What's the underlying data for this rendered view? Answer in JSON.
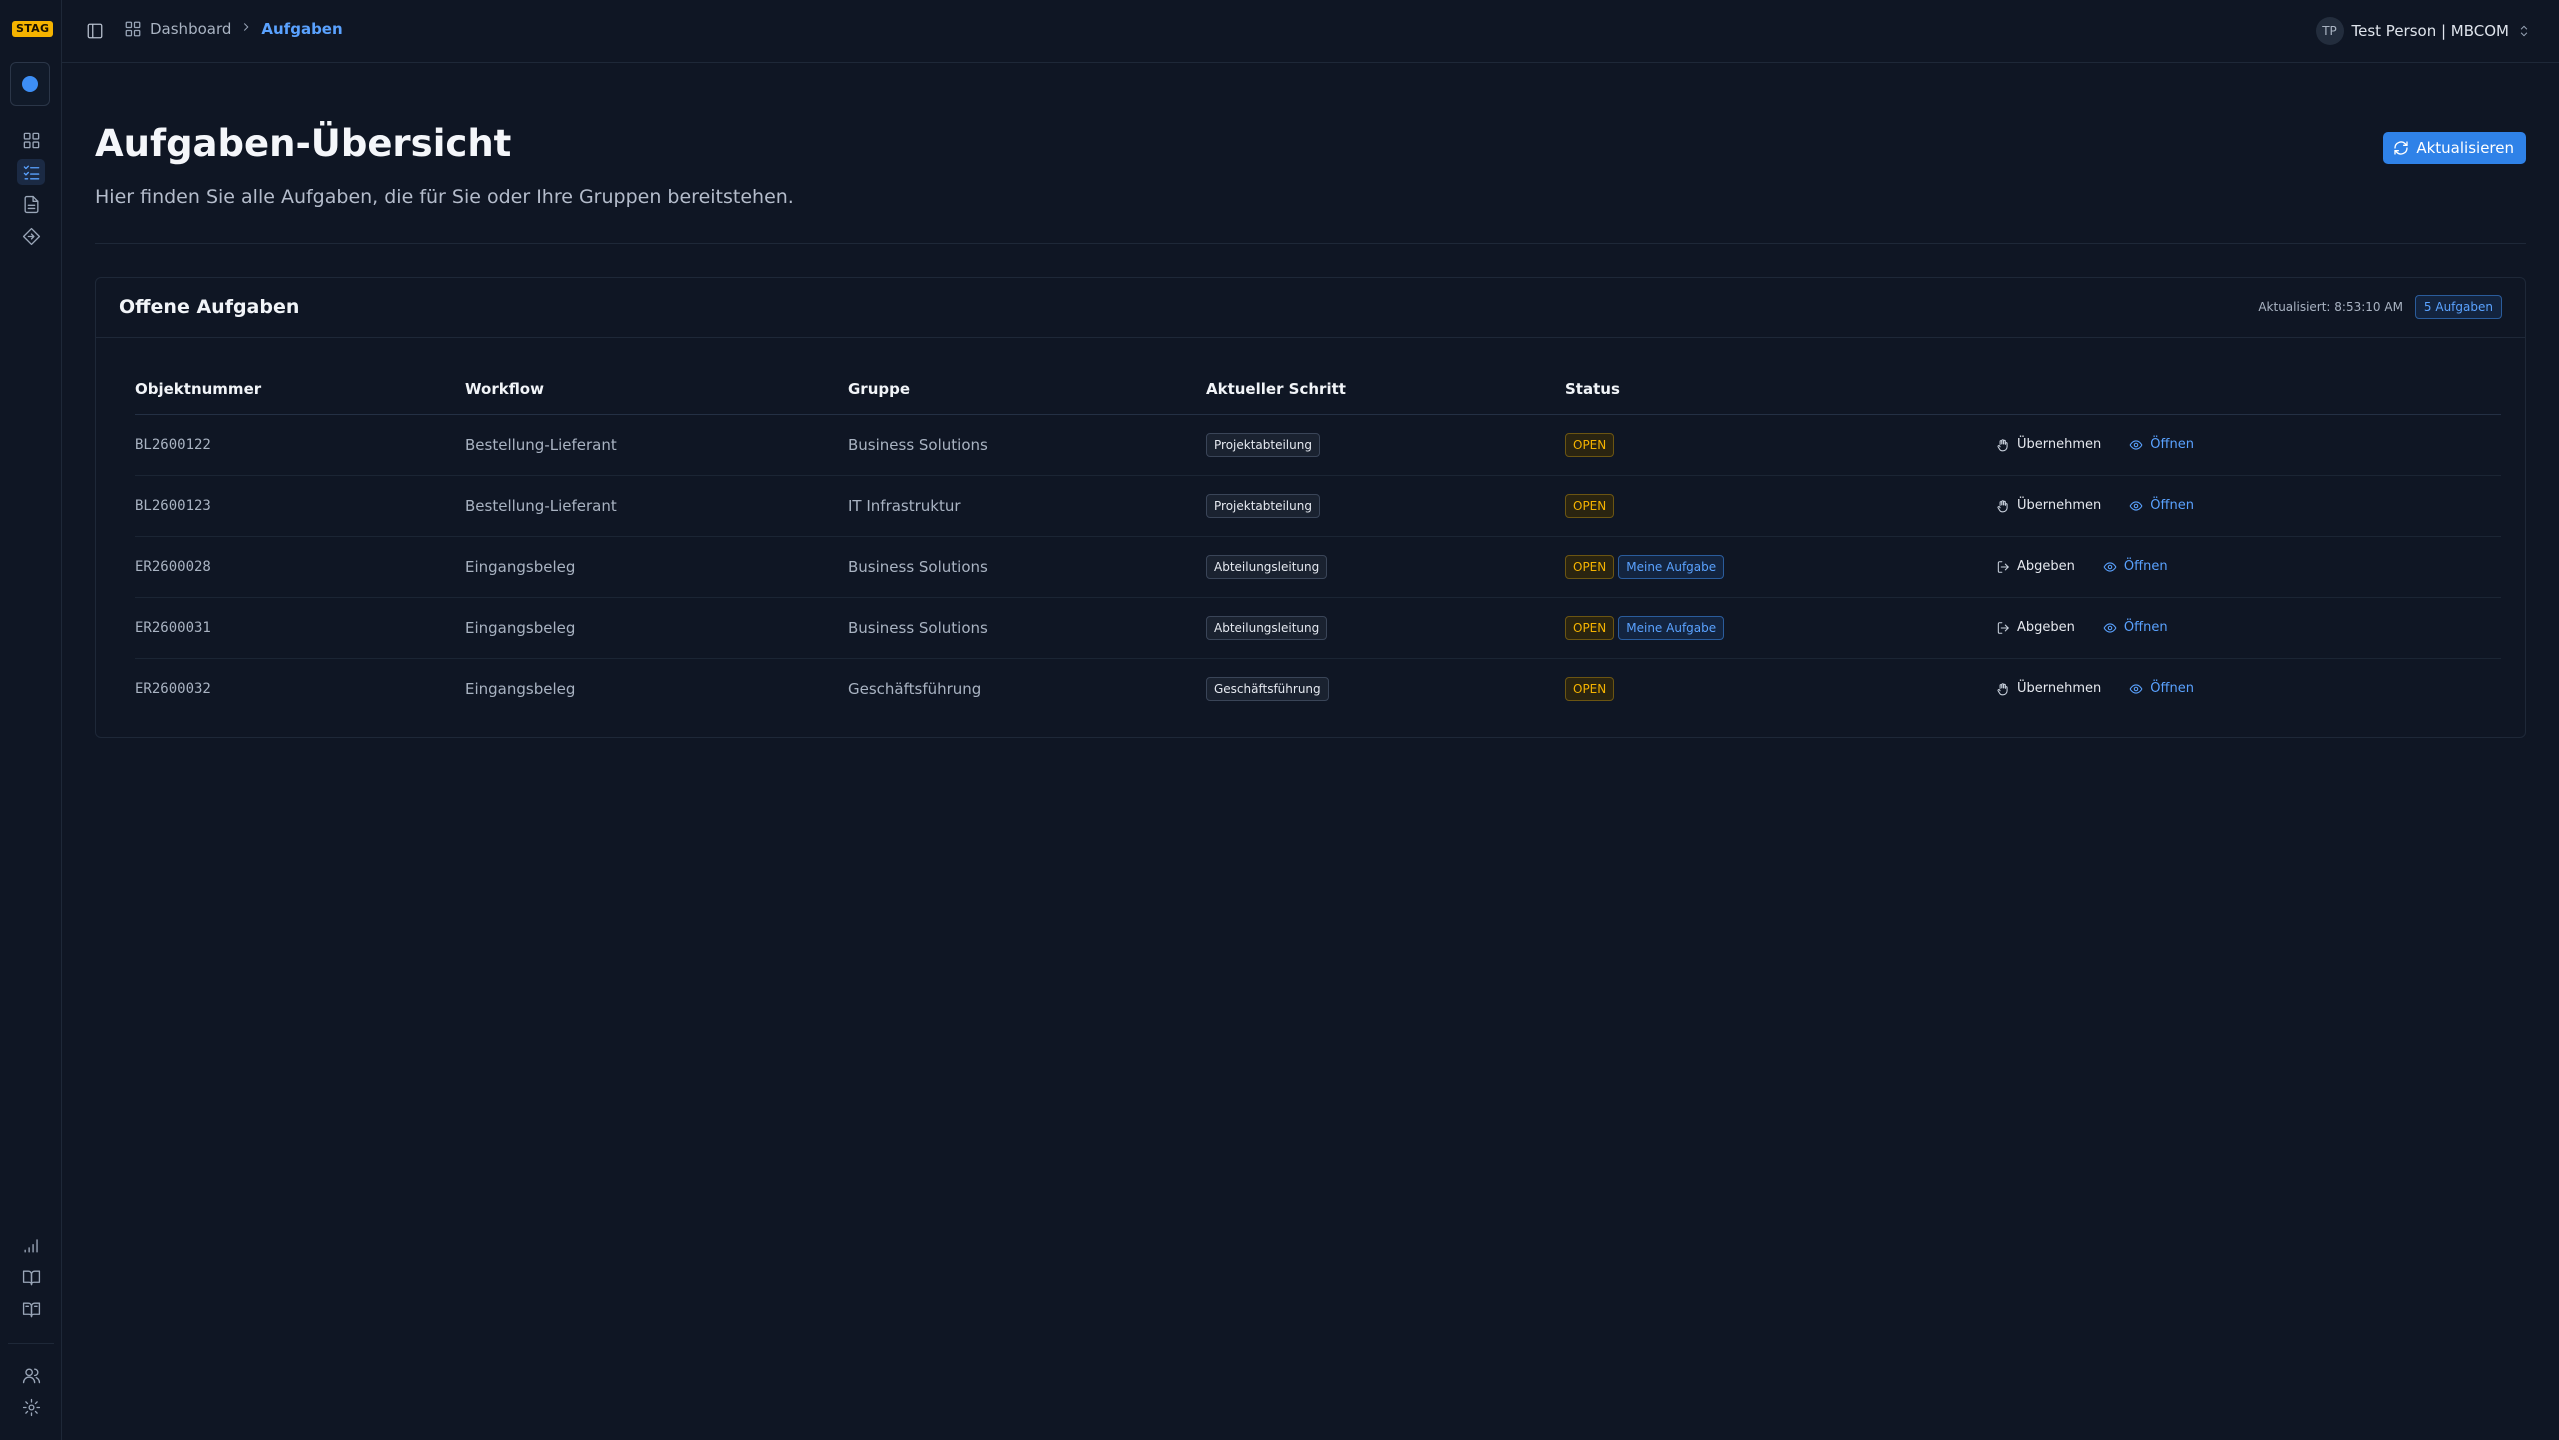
{
  "env_badge": "STAG",
  "breadcrumb": {
    "home": "Dashboard",
    "current": "Aufgaben"
  },
  "user": {
    "initials": "TP",
    "label": "Test Person | MBCOM"
  },
  "page": {
    "title": "Aufgaben-Übersicht",
    "subtitle": "Hier finden Sie alle Aufgaben, die für Sie oder Ihre Gruppen bereitstehen.",
    "refresh_label": "Aktualisieren"
  },
  "card": {
    "title": "Offene Aufgaben",
    "updated": "Aktualisiert: 8:53:10 AM",
    "count": "5 Aufgaben"
  },
  "table": {
    "headers": [
      "Objektnummer",
      "Workflow",
      "Gruppe",
      "Aktueller Schritt",
      "Status",
      ""
    ],
    "rows": [
      {
        "object": "BL2600122",
        "workflow": "Bestellung-Lieferant",
        "group": "Business Solutions",
        "step": "Projektabteilung",
        "status": "OPEN",
        "mine": "",
        "action": "Übernehmen",
        "open": "Öffnen"
      },
      {
        "object": "BL2600123",
        "workflow": "Bestellung-Lieferant",
        "group": "IT Infrastruktur",
        "step": "Projektabteilung",
        "status": "OPEN",
        "mine": "",
        "action": "Übernehmen",
        "open": "Öffnen"
      },
      {
        "object": "ER2600028",
        "workflow": "Eingangsbeleg",
        "group": "Business Solutions",
        "step": "Abteilungsleitung",
        "status": "OPEN",
        "mine": "Meine Aufgabe",
        "action": "Abgeben",
        "open": "Öffnen"
      },
      {
        "object": "ER2600031",
        "workflow": "Eingangsbeleg",
        "group": "Business Solutions",
        "step": "Abteilungsleitung",
        "status": "OPEN",
        "mine": "Meine Aufgabe",
        "action": "Abgeben",
        "open": "Öffnen"
      },
      {
        "object": "ER2600032",
        "workflow": "Eingangsbeleg",
        "group": "Geschäftsführung",
        "step": "Geschäftsführung",
        "status": "OPEN",
        "mine": "",
        "action": "Übernehmen",
        "open": "Öffnen"
      }
    ]
  },
  "colors": {
    "accent": "#3d8ef5",
    "status_open": "#f5b300",
    "background": "#0f1624"
  },
  "icons": {
    "rail_top": [
      "dashboard-icon",
      "task-list-icon",
      "document-icon",
      "workflow-icon"
    ],
    "rail_bottom": [
      "signal-icon",
      "book-open-icon",
      "book-icon",
      "users-icon",
      "gear-icon"
    ]
  }
}
